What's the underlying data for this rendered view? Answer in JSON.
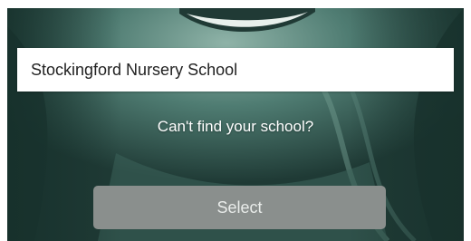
{
  "school_search": {
    "value": "Stockingford Nursery School"
  },
  "cant_find_label": "Can't find your school?",
  "select_label": "Select",
  "colors": {
    "overlay_teal": "#3d6b62",
    "button_gray": "#8a8f8d",
    "field_white": "#ffffff"
  }
}
